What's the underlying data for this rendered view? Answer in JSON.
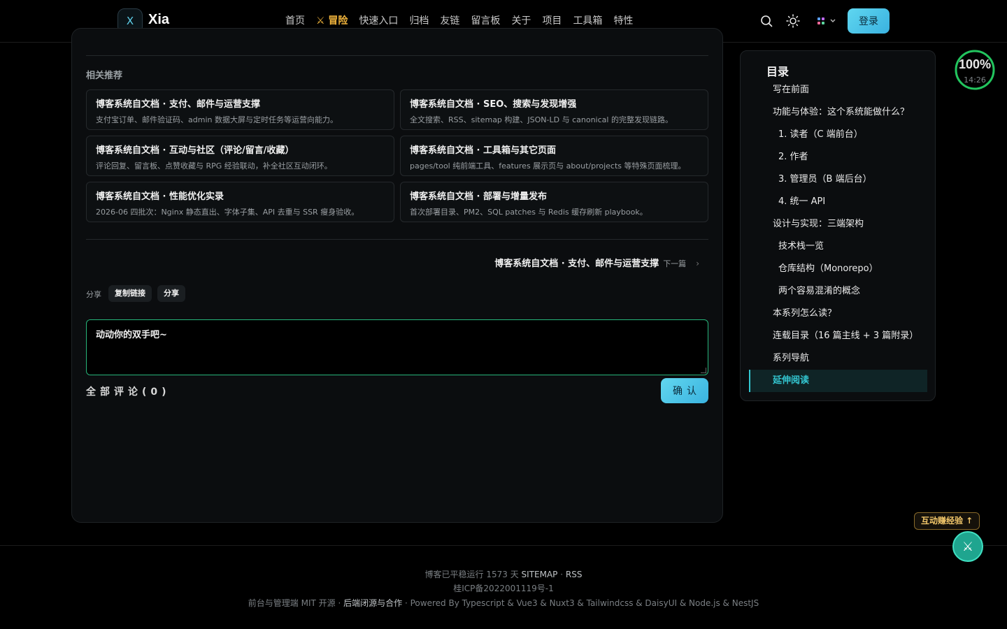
{
  "header": {
    "logo_letter": "X",
    "site_name": "Xia",
    "nav": [
      {
        "label": "首页",
        "active": false
      },
      {
        "label": "⚔ 冒险",
        "active": true
      },
      {
        "label": "快速入口",
        "active": false
      },
      {
        "label": "归档",
        "active": false
      },
      {
        "label": "友链",
        "active": false
      },
      {
        "label": "留言板",
        "active": false
      },
      {
        "label": "关于",
        "active": false
      },
      {
        "label": "项目",
        "active": false
      },
      {
        "label": "工具箱",
        "active": false
      },
      {
        "label": "特性",
        "active": false
      }
    ],
    "icons": [
      "search-icon",
      "theme-sun-icon",
      "app-grid-icon"
    ],
    "login_label": "登录"
  },
  "related": {
    "title": "相关推荐",
    "items": [
      {
        "title": "博客系统自文档 · 支付、邮件与运营支撑",
        "desc": "支付宝订单、邮件验证码、admin 数据大屏与定时任务等运营向能力。"
      },
      {
        "title": "博客系统自文档 · SEO、搜索与发现增强",
        "desc": "全文搜索、RSS、sitemap 构建、JSON-LD 与 canonical 的完整发现链路。"
      },
      {
        "title": "博客系统自文档 · 互动与社区（评论/留言/收藏）",
        "desc": "评论回复、留言板、点赞收藏与 RPG 经验联动，补全社区互动闭环。"
      },
      {
        "title": "博客系统自文档 · 工具箱与其它页面",
        "desc": "pages/tool 纯前端工具、features 展示页与 about/projects 等特殊页面梳理。"
      },
      {
        "title": "博客系统自文档 · 性能优化实录",
        "desc": "2026-06 四批次：Nginx 静态直出、字体子集、API 去重与 SSR 瘦身验收。"
      },
      {
        "title": "博客系统自文档 · 部署与增量发布",
        "desc": "首次部署目录、PM2、SQL patches 与 Redis 缓存刷新 playbook。"
      }
    ]
  },
  "next_post": {
    "title": "博客系统自文档 · 支付、邮件与运营支撑",
    "label": "下一篇"
  },
  "share": {
    "label": "分享",
    "copy_link": "复制链接",
    "share": "分享"
  },
  "comment": {
    "placeholder": "动动你的双手吧~",
    "all_comments": "全部评论(0)",
    "confirm": "确认"
  },
  "toc": {
    "title": "目录",
    "items": [
      {
        "label": "写在前面",
        "level": 1
      },
      {
        "label": "功能与体验：这个系统能做什么？",
        "level": 1
      },
      {
        "label": "1. 读者（C 端前台）",
        "level": 2
      },
      {
        "label": "2. 作者",
        "level": 2
      },
      {
        "label": "3. 管理员（B 端后台）",
        "level": 2
      },
      {
        "label": "4. 统一 API",
        "level": 2
      },
      {
        "label": "设计与实现：三端架构",
        "level": 1
      },
      {
        "label": "技术栈一览",
        "level": 2
      },
      {
        "label": "仓库结构（Monorepo）",
        "level": 2
      },
      {
        "label": "两个容易混淆的概念",
        "level": 2
      },
      {
        "label": "本系列怎么读？",
        "level": 1
      },
      {
        "label": "连载目录（16 篇主线 + 3 篇附录）",
        "level": 1
      },
      {
        "label": "系列导航",
        "level": 1
      },
      {
        "label": "延伸阅读",
        "level": 1,
        "active": true
      }
    ]
  },
  "progress": {
    "percent_text": "100%",
    "percent": 100,
    "time": "14:26"
  },
  "footer": {
    "line1_prefix": "博客已平稳运行 1573 天",
    "sitemap": "SITEMAP",
    "rss": "RSS",
    "icp": "桂ICP备2022001119号-1",
    "line3_prefix": "前台与管理端 MIT 开源",
    "line3_link": "后端闭源与合作",
    "line3_suffix": "Powered By Typescript & Vue3 & Nuxt3 & Tailwindcss & DaisyUI & Node.js & NestJS"
  },
  "floating": {
    "xp_label": "互动赚经验 ↑"
  },
  "colors": {
    "accent_cyan": "#3ab2e0",
    "active_nav": "#f2b53c",
    "toc_active": "#33c6d1",
    "comment_border": "#27b57a",
    "progress_ring": "#22c55e"
  }
}
